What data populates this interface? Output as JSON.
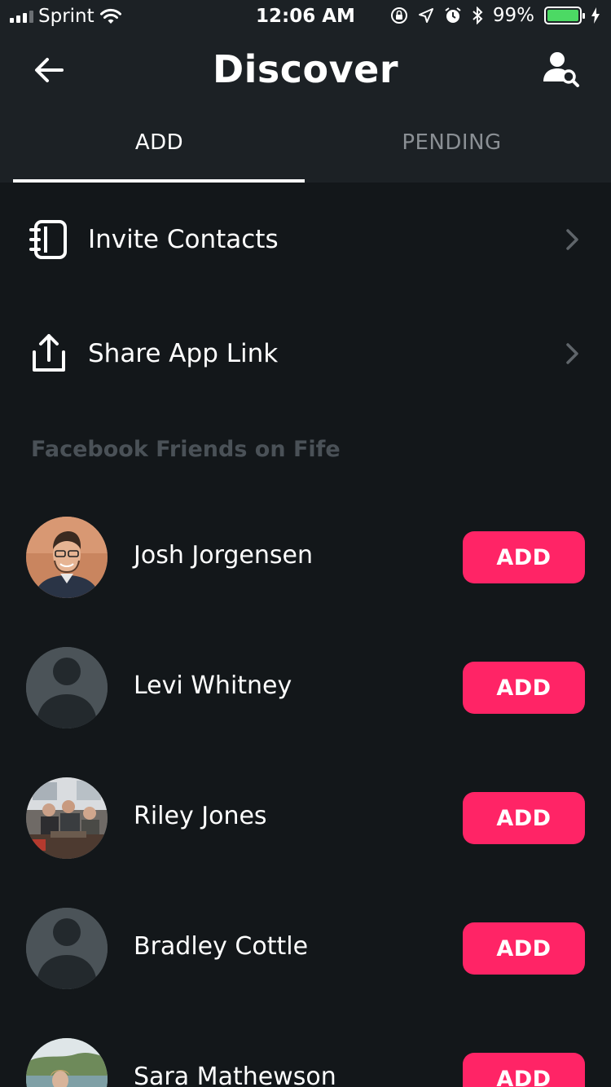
{
  "status_bar": {
    "carrier": "Sprint",
    "time": "12:06 AM",
    "battery_percent": "99%",
    "battery_level": 0.99,
    "icons": [
      "signal-icon",
      "wifi-icon",
      "orientation-lock-icon",
      "location-icon",
      "alarm-icon",
      "bluetooth-icon",
      "battery-icon",
      "charging-icon"
    ]
  },
  "header": {
    "title": "Discover",
    "back_icon": "arrow-left-icon",
    "find_icon": "user-search-icon"
  },
  "tabs": [
    {
      "label": "ADD",
      "active": true
    },
    {
      "label": "PENDING",
      "active": false
    }
  ],
  "actions": [
    {
      "label": "Invite Contacts",
      "icon": "contacts-book-icon"
    },
    {
      "label": "Share App Link",
      "icon": "share-icon"
    }
  ],
  "section_title": "Facebook Friends on Fife",
  "add_label": "ADD",
  "friends": [
    {
      "name": "Josh Jorgensen",
      "avatar": "photo"
    },
    {
      "name": "Levi Whitney",
      "avatar": "placeholder"
    },
    {
      "name": "Riley Jones",
      "avatar": "photo"
    },
    {
      "name": "Bradley Cottle",
      "avatar": "placeholder"
    },
    {
      "name": "Sara Mathewson",
      "avatar": "photo"
    }
  ],
  "colors": {
    "background": "#13171a",
    "header": "#1c2125",
    "accent": "#ff2466",
    "section_text": "#4a5157",
    "inactive_tab": "#8a8f94"
  }
}
